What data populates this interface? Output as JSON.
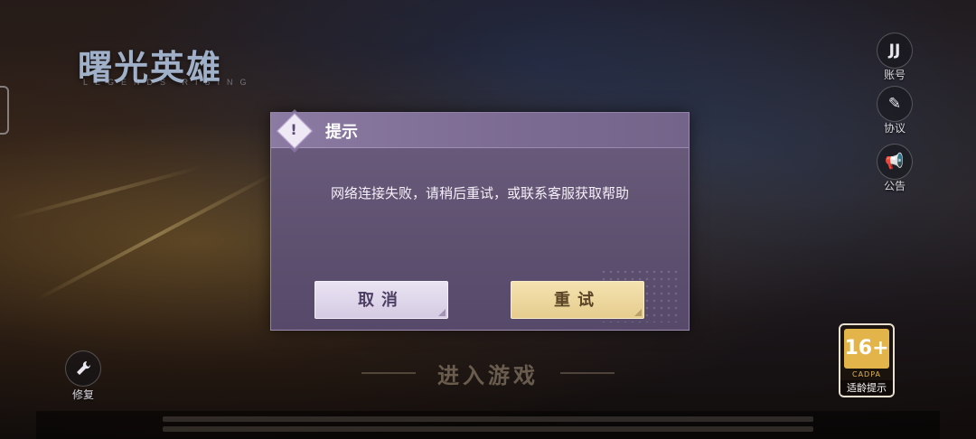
{
  "logo": {
    "title": "曙光英雄",
    "subtitle": "LEGENDS RISING"
  },
  "side_menu": [
    {
      "icon": "account-icon",
      "glyph": "JJ",
      "label": "账号"
    },
    {
      "icon": "agreement-icon",
      "glyph": "✎",
      "label": "协议"
    },
    {
      "icon": "announcement-icon",
      "glyph": "📢",
      "label": "公告"
    }
  ],
  "repair": {
    "label": "修复"
  },
  "enter_game": {
    "label": "进入游戏"
  },
  "age_rating": {
    "value": "16+",
    "org": "CADPA",
    "tip": "适龄提示"
  },
  "dialog": {
    "title": "提示",
    "message": "网络连接失败，请稍后重试，或联系客服获取帮助",
    "cancel_label": "取消",
    "retry_label": "重试"
  },
  "colors": {
    "dialog_bg": "#5e506f",
    "dialog_header": "#7b6a92",
    "cancel_button": "#e2daee",
    "retry_button": "#eed7a0"
  }
}
